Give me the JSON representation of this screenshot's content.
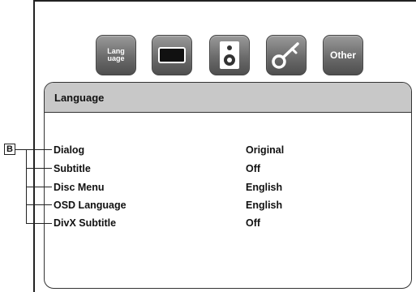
{
  "tabs": [
    {
      "label": "Lang\nuage",
      "icon": "language-icon"
    },
    {
      "label": "",
      "icon": "display-icon"
    },
    {
      "label": "",
      "icon": "speaker-icon"
    },
    {
      "label": "",
      "icon": "key-icon"
    },
    {
      "label": "Other",
      "icon": "other-icon"
    }
  ],
  "panel": {
    "title": "Language",
    "rows": [
      {
        "label": "Dialog",
        "value": "Original"
      },
      {
        "label": "Subtitle",
        "value": "Off"
      },
      {
        "label": "Disc Menu",
        "value": "English"
      },
      {
        "label": "OSD Language",
        "value": "English"
      },
      {
        "label": "DivX Subtitle",
        "value": "Off"
      }
    ]
  },
  "callout": {
    "letter": "B"
  }
}
